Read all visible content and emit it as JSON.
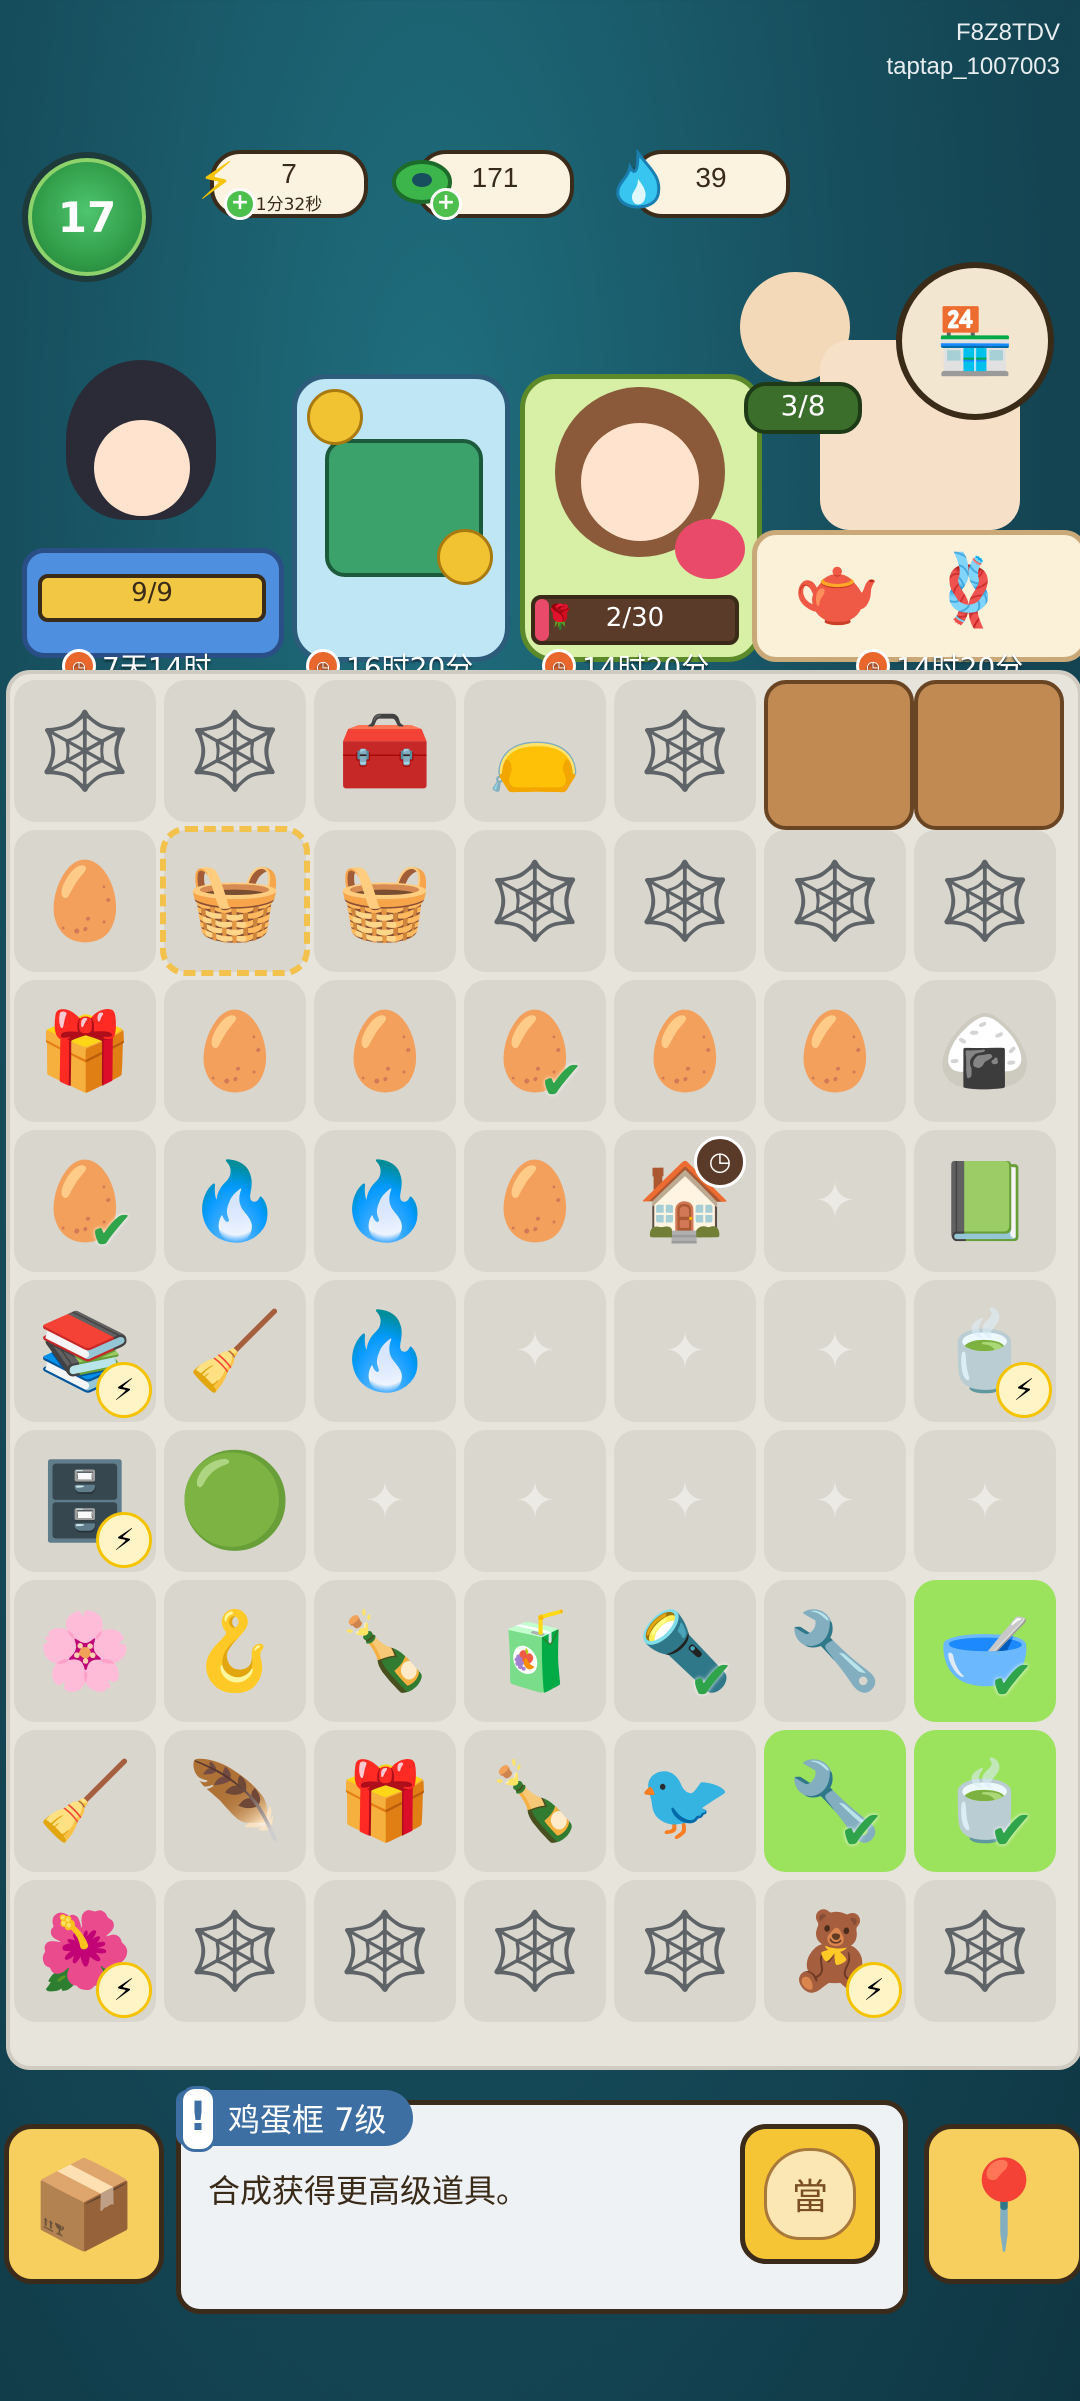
{
  "watermark": {
    "line1": "F8Z8TDV",
    "line2": "taptap_1007003"
  },
  "player": {
    "level": "17"
  },
  "currencies": [
    {
      "name": "energy",
      "icon": "lightning-bolt-icon",
      "value": "7",
      "sub": "1分32秒"
    },
    {
      "name": "jade-coin",
      "icon": "jade-coin-icon",
      "value": "171"
    },
    {
      "name": "blue-flame",
      "icon": "blue-flame-icon",
      "value": "39"
    }
  ],
  "cards": [
    {
      "name": "character-1",
      "progress": "9/9",
      "progress_fraction": 1.0,
      "timer": "7天14时"
    },
    {
      "name": "treasure-cauldron",
      "timer": "16时20分"
    },
    {
      "name": "character-2",
      "progress": "2/30",
      "progress_fraction": 0.067,
      "timer": "14时20分"
    },
    {
      "name": "shop-order",
      "count": "3/8",
      "timer": "14时20分"
    }
  ],
  "board": {
    "rows": [
      [
        "web-pot",
        "web-sack",
        "treasure-chest",
        "lucky-pouch",
        "web-basket",
        "wood-plank",
        "wood-plank"
      ],
      [
        "egg-crate",
        "gift-basket",
        "gift-basket",
        "web-gourd",
        "web-bottle",
        "web-bottle",
        "web-jar"
      ],
      [
        "gift-box",
        "egg-crate",
        "egg-crate",
        "eggs-checked",
        "egg-crate",
        "egg-crate",
        "zongzi"
      ],
      [
        "eggs-checked",
        "blue-flames",
        "blue-flames",
        "single-egg",
        "market-stall",
        "empty",
        "jade-book"
      ],
      [
        "bookshelf-bolt",
        "whisk-broom",
        "blue-flame",
        "empty",
        "empty",
        "empty",
        "tea-set-bolt"
      ],
      [
        "cabinet-bolt",
        "jade-coins",
        "empty",
        "empty",
        "empty",
        "empty",
        "empty"
      ],
      [
        "silk-pillow",
        "hook-tool",
        "soda-bottle",
        "iced-tea",
        "flashlight-checked",
        "slingshot-tool",
        "bowl-checked"
      ],
      [
        "whisk-broom",
        "feather-broom",
        "mystery-gift",
        "soda-bottle",
        "bird-whistle",
        "slingshot-checked",
        "cup-checked"
      ],
      [
        "flower-pot-bolt",
        "web-sack",
        "web-sack",
        "web-urn",
        "web-stove",
        "toy-chest-bolt",
        "web-jar"
      ]
    ]
  },
  "info": {
    "title": "鸡蛋框 7级",
    "description": "合成获得更高级道具。",
    "dang_label": "當"
  },
  "bottom": {
    "inventory_icon": "cardboard-box-icon",
    "map_icon": "map-phone-icon"
  }
}
